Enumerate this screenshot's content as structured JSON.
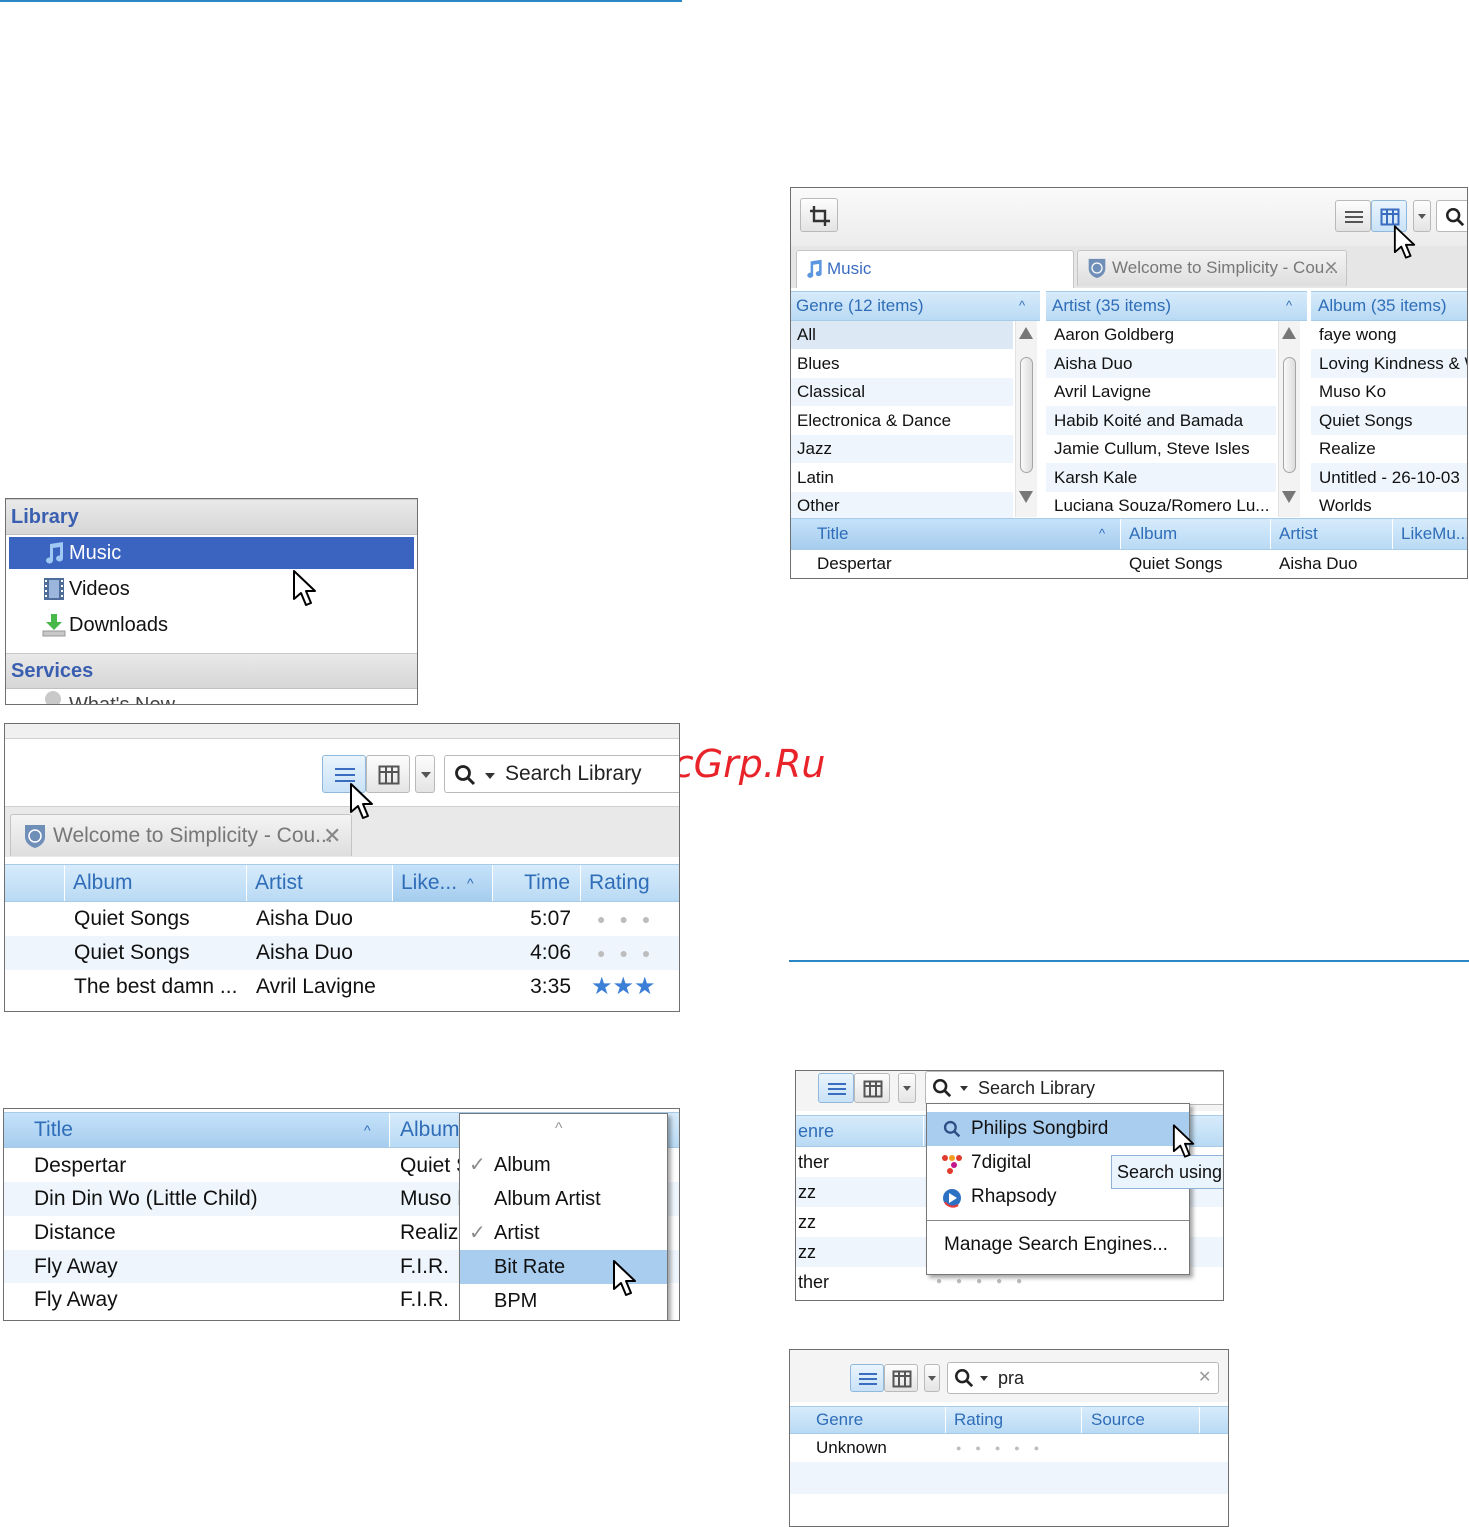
{
  "watermark": "McGrp.Ru",
  "colors": {
    "accent": "#2b86c5",
    "selection": "#3b64c0",
    "header_text": "#2f6db8",
    "star": "#3b7fd6",
    "watermark": "#e8232a"
  },
  "library_panel": {
    "library_heading": "Library",
    "items": [
      {
        "label": "Music",
        "icon": "music-note-icon",
        "selected": true
      },
      {
        "label": "Videos",
        "icon": "film-icon",
        "selected": false
      },
      {
        "label": "Downloads",
        "icon": "download-icon",
        "selected": false
      }
    ],
    "services_heading": "Services",
    "partial_item": "What's New"
  },
  "list_view": {
    "search_placeholder": "Search Library",
    "tab_label": "Welcome to Simplicity - Cou...",
    "columns": [
      "Album",
      "Artist",
      "Like...",
      "Time",
      "Rating"
    ],
    "rows": [
      {
        "album": "Quiet Songs",
        "artist": "Aisha Duo",
        "time": "5:07",
        "rating": 0
      },
      {
        "album": "Quiet Songs",
        "artist": "Aisha Duo",
        "time": "4:06",
        "rating": 0
      },
      {
        "album": "The best damn ...",
        "artist": "Avril Lavigne",
        "time": "3:35",
        "rating": 3
      }
    ]
  },
  "column_menu_view": {
    "columns": [
      "Title",
      "Album"
    ],
    "rows": [
      {
        "title": "Despertar",
        "album": "Quiet S"
      },
      {
        "title": "Din Din Wo (Little Child)",
        "album": "Muso K"
      },
      {
        "title": "Distance",
        "album": "Realize"
      },
      {
        "title": "Fly Away",
        "album": "F.I.R."
      },
      {
        "title": "Fly Away",
        "album": "F.I.R."
      }
    ],
    "menu_items": [
      {
        "label": "Album",
        "checked": true,
        "highlighted": false
      },
      {
        "label": "Album Artist",
        "checked": false,
        "highlighted": false
      },
      {
        "label": "Artist",
        "checked": true,
        "highlighted": false
      },
      {
        "label": "Bit Rate",
        "checked": false,
        "highlighted": true
      },
      {
        "label": "BPM",
        "checked": false,
        "highlighted": false
      }
    ]
  },
  "filter_view": {
    "tab_music": "Music",
    "tab_welcome": "Welcome to Simplicity - Cou...",
    "genre_header": "Genre (12 items)",
    "artist_header": "Artist (35 items)",
    "album_header": "Album (35 items)",
    "genres": [
      "All",
      "Blues",
      "Classical",
      "Electronica & Dance",
      "Jazz",
      "Latin",
      "Other"
    ],
    "artists": [
      "Aaron Goldberg",
      "Aisha Duo",
      "Avril Lavigne",
      "Habib Koité and Bamada",
      "Jamie Cullum, Steve Isles",
      "Karsh Kale",
      "Luciana Souza/Romero Lu..."
    ],
    "albums": [
      "faye wong",
      "Loving Kindness & W",
      "Muso Ko",
      "Quiet Songs",
      "Realize",
      "Untitled - 26-10-03",
      "Worlds"
    ],
    "track_columns": [
      "Title",
      "Album",
      "Artist",
      "LikeMu..."
    ],
    "track_row": {
      "title": "Despertar",
      "album": "Quiet Songs",
      "artist": "Aisha Duo"
    }
  },
  "search_engine_view": {
    "search_placeholder": "Search Library",
    "genre_fragment": "enre",
    "row_fragments": [
      "ther",
      "zz",
      "zz",
      "zz",
      "ther"
    ],
    "engines": [
      {
        "label": "Philips Songbird",
        "icon": "search-icon",
        "highlighted": true
      },
      {
        "label": "7digital",
        "icon": "7digital-icon",
        "highlighted": false
      },
      {
        "label": "Rhapsody",
        "icon": "rhapsody-icon",
        "highlighted": false
      }
    ],
    "manage_label": "Manage Search Engines...",
    "tooltip": "Search using"
  },
  "search_query_view": {
    "query": "pra",
    "columns": [
      "Genre",
      "Rating",
      "Source"
    ],
    "row_genre": "Unknown"
  }
}
